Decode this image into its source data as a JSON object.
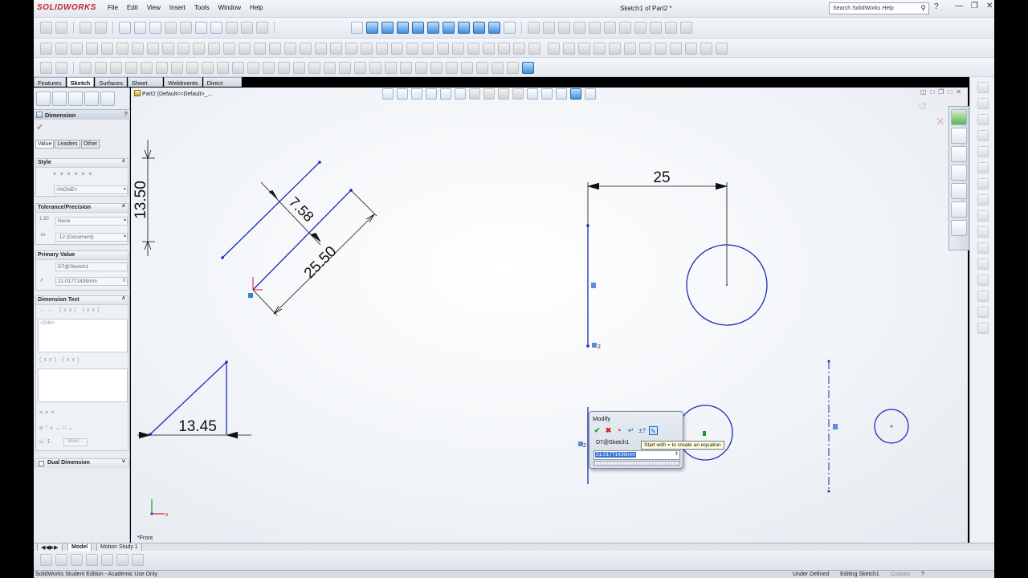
{
  "app": {
    "logo": "SOLIDWORKS",
    "document_title": "Sketch1 of Part2 *"
  },
  "menu": [
    "File",
    "Edit",
    "View",
    "Insert",
    "Tools",
    "Window",
    "Help"
  ],
  "search": {
    "placeholder": "Search SolidWorks Help"
  },
  "command_tabs": [
    "Features",
    "Sketch",
    "Surfaces",
    "Sheet Metal",
    "Weldments",
    "Direct Editing"
  ],
  "active_command_tab": "Sketch",
  "property_manager": {
    "title": "Dimension",
    "subtabs": [
      "Value",
      "Leaders",
      "Other"
    ],
    "style": {
      "title": "Style",
      "value": "<NONE>"
    },
    "tolerance": {
      "title": "Tolerance/Precision",
      "tolerance_type": "None",
      "precision": ".12 (Document)"
    },
    "primary_value": {
      "title": "Primary Value",
      "name": "D7@Sketch1",
      "value": "21.01771439mm"
    },
    "dimension_text": {
      "title": "Dimension Text",
      "dim_token": "<DIM>",
      "more_label": "More..."
    },
    "dual_dimension": {
      "title": "Dual Dimension"
    }
  },
  "tree": {
    "root": "Part2  (Default<<Default>_..."
  },
  "sketch": {
    "dims": {
      "d1": "13.50",
      "d2": "7.58",
      "d3": "25.50",
      "d4": "25",
      "d5": "13.45"
    },
    "relation_markers": {
      "m1": "2",
      "m2": "2"
    }
  },
  "modify_dialog": {
    "title": "Modify",
    "dim_name": "D7@Sketch1",
    "value": "21.01771439mm",
    "tooltip": "Start with = to create an equation"
  },
  "view_label": "*Front",
  "bottom_tabs": [
    "Model",
    "Motion Study 1"
  ],
  "status": {
    "edition": "SolidWorks Student Edition - Academic Use Only",
    "state": "Under Defined",
    "mode": "Editing Sketch1",
    "units": "Custom"
  },
  "colors": {
    "sketch_blue": "#1b2cb8",
    "dim_black": "#111111",
    "accent_red": "#c0262d"
  }
}
